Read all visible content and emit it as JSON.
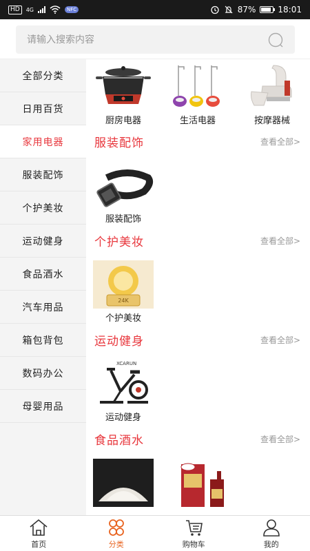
{
  "status_bar": {
    "hd": "HD",
    "network": "4G",
    "nfc": "NFC",
    "battery": "87%",
    "time": "18:01"
  },
  "search": {
    "placeholder": "请输入搜索内容"
  },
  "sidebar": {
    "items": [
      {
        "label": "全部分类"
      },
      {
        "label": "日用百货"
      },
      {
        "label": "家用电器"
      },
      {
        "label": "服装配饰"
      },
      {
        "label": "个护美妆"
      },
      {
        "label": "运动健身"
      },
      {
        "label": "食品酒水"
      },
      {
        "label": "汽车用品"
      },
      {
        "label": "箱包背包"
      },
      {
        "label": "数码办公"
      },
      {
        "label": "母婴用品"
      }
    ],
    "active_index": 2
  },
  "content": {
    "top_tiles": [
      {
        "label": "厨房电器",
        "icon": "cooker-image"
      },
      {
        "label": "生活电器",
        "icon": "steamer-image"
      },
      {
        "label": "按摩器械",
        "icon": "massage-chair-image"
      }
    ],
    "sections": [
      {
        "title": "服装配饰",
        "see_all": "查看全部>",
        "tiles": [
          {
            "label": "服装配饰",
            "icon": "belt-image"
          }
        ]
      },
      {
        "title": "个护美妆",
        "see_all": "查看全部>",
        "tiles": [
          {
            "label": "个护美妆",
            "icon": "cream-jar-image"
          }
        ]
      },
      {
        "title": "运动健身",
        "see_all": "查看全部>",
        "tiles": [
          {
            "label": "运动健身",
            "icon": "exercise-bike-image"
          }
        ]
      },
      {
        "title": "食品酒水",
        "see_all": "查看全部>",
        "tiles": [
          {
            "label": "",
            "icon": "rice-image"
          },
          {
            "label": "",
            "icon": "liquor-box-image"
          }
        ]
      }
    ],
    "product_text": {
      "cream_brand": "24K",
      "bike_brand": "XCARUN"
    }
  },
  "tabbar": {
    "tabs": [
      {
        "label": "首页",
        "icon": "home-icon"
      },
      {
        "label": "分类",
        "icon": "category-icon"
      },
      {
        "label": "购物车",
        "icon": "cart-icon"
      },
      {
        "label": "我的",
        "icon": "user-icon"
      }
    ],
    "active_index": 1
  },
  "colors": {
    "accent": "#e8373d",
    "tab_active": "#e8631f",
    "sidebar_bg": "#f4f4f4"
  }
}
